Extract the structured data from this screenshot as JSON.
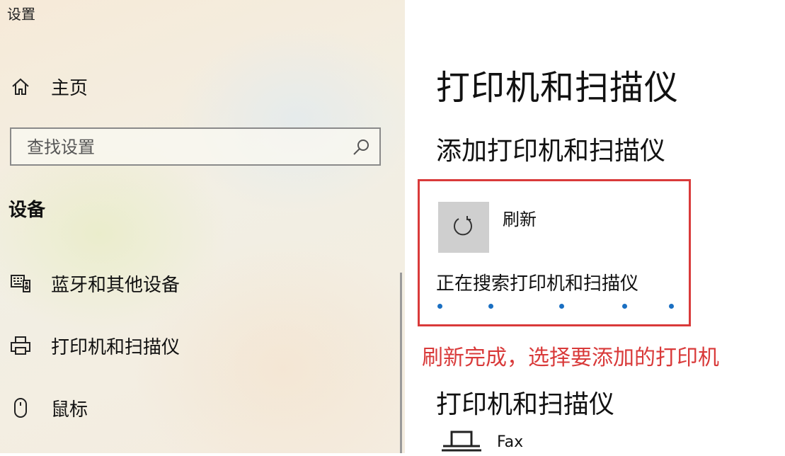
{
  "window": {
    "title": "设置"
  },
  "sidebar": {
    "home": {
      "label": "主页",
      "icon": "home-icon"
    },
    "search": {
      "placeholder": "查找设置",
      "icon": "search-icon"
    },
    "section_heading": "设备",
    "items": [
      {
        "label": "蓝牙和其他设备",
        "icon": "bluetooth-devices-icon"
      },
      {
        "label": "打印机和扫描仪",
        "icon": "printer-icon"
      },
      {
        "label": "鼠标",
        "icon": "mouse-icon"
      }
    ]
  },
  "main": {
    "title": "打印机和扫描仪",
    "add_section": {
      "heading": "添加打印机和扫描仪",
      "refresh_label": "刷新",
      "refresh_icon": "refresh-icon",
      "status_text": "正在搜索打印机和扫描仪"
    },
    "annotation": "刷新完成，选择要添加的打印机",
    "printers_section": {
      "heading": "打印机和扫描仪",
      "items": [
        {
          "name": "Fax",
          "icon": "fax-printer-icon"
        }
      ]
    }
  },
  "colors": {
    "accent": "#1a6fc2",
    "annotation_red": "#d93a3a"
  }
}
